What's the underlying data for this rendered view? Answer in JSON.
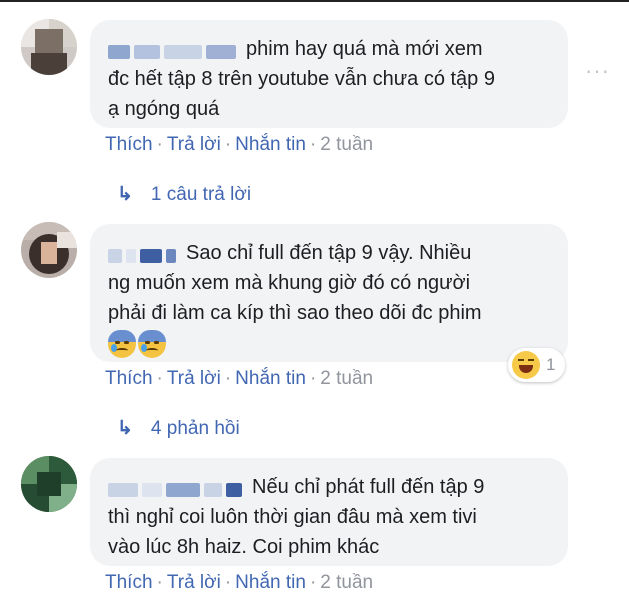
{
  "comments": [
    {
      "text_line1": "phim hay quá mà mới xem",
      "text_line2": "đc hết tập 8 trên youtube vẫn chưa có tập 9",
      "text_line3": "ạ ngóng quá",
      "actions": {
        "like": "Thích",
        "reply": "Trả lời",
        "message": "Nhắn tin",
        "time": "2 tuần"
      },
      "replies_label": "1 câu trả lời",
      "more_icon": "more-dots-icon"
    },
    {
      "text_line1": "Sao chỉ full đến tập 9 vậy. Nhiều",
      "text_line2": "ng muốn xem mà khung giờ đó có người",
      "text_line3": "phải đi làm ca kíp thì sao theo dõi đc phim",
      "emoji_icons": [
        "sad-sweat-emoji",
        "sad-sweat-emoji"
      ],
      "reaction": {
        "icon": "haha-reaction-icon",
        "count": "1"
      },
      "actions": {
        "like": "Thích",
        "reply": "Trả lời",
        "message": "Nhắn tin",
        "time": "2 tuần"
      },
      "replies_label": "4 phản hồi"
    },
    {
      "text_line1": "Nếu chỉ phát full đến tập 9",
      "text_line2": "thì nghỉ coi luôn thời gian đâu mà xem tivi",
      "text_line3": "vào lúc 8h haiz. Coi phim khác",
      "actions": {
        "like": "Thích",
        "reply": "Trả lời",
        "message": "Nhắn tin",
        "time": "2 tuần"
      }
    }
  ],
  "separator": "·",
  "reply_arrow": "↳",
  "colors": {
    "link": "#4267b2",
    "muted": "#90949c",
    "bubble": "#f2f3f5",
    "text": "#1c1e21"
  }
}
